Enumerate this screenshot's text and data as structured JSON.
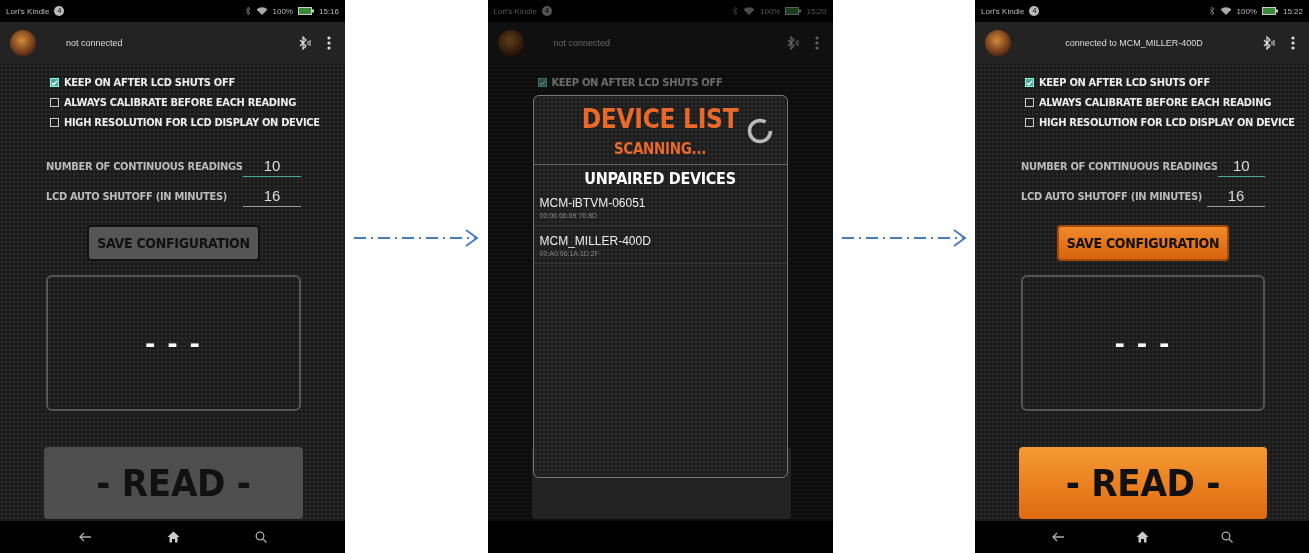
{
  "screens": [
    {
      "dimmed": false,
      "nav_buttons": true,
      "status_bar": {
        "device": "Lori's Kindle",
        "badge": "4",
        "battery": "100%",
        "time": "15:16"
      },
      "app_bar": {
        "status": "not connected"
      },
      "options": [
        {
          "label": "KEEP ON AFTER LCD SHUTS OFF",
          "checked": true
        },
        {
          "label": "ALWAYS CALIBRATE BEFORE EACH READING",
          "checked": false
        },
        {
          "label": "HIGH RESOLUTION FOR LCD DISPLAY ON DEVICE",
          "checked": false
        }
      ],
      "fields": [
        {
          "label": "NUMBER OF CONTINUOUS READINGS",
          "value": "10",
          "focused": true
        },
        {
          "label": "LCD AUTO SHUTOFF (IN MINUTES)",
          "value": "16",
          "focused": false
        }
      ],
      "save_button": {
        "label": "SAVE CONFIGURATION",
        "enabled": false
      },
      "display": {
        "value": "- - -"
      },
      "read_button": {
        "label": "- READ -",
        "enabled": false
      }
    },
    {
      "dimmed": true,
      "nav_buttons": false,
      "status_bar": {
        "device": "Lori's Kindle",
        "badge": "4",
        "battery": "100%",
        "time": "15:20"
      },
      "app_bar": {
        "status": "not connected"
      },
      "options": [
        {
          "label": "KEEP ON AFTER LCD SHUTS OFF",
          "checked": true
        }
      ],
      "read_button": {
        "enabled": false
      },
      "dialog": {
        "title": "DEVICE LIST",
        "subtitle": "SCANNING...",
        "section": "UNPAIRED DEVICES",
        "devices": [
          {
            "name": "MCM-iBTVM-06051",
            "address": "00:06:66:69:76:8D"
          },
          {
            "name": "MCM_MILLER-400D",
            "address": "00:A0:96:1A:1D:2F"
          }
        ]
      }
    },
    {
      "dimmed": false,
      "nav_buttons": true,
      "status_bar": {
        "device": "Lori's Kindle",
        "badge": "4",
        "battery": "100%",
        "time": "15:22"
      },
      "app_bar": {
        "status": "connected to MCM_MILLER-400D"
      },
      "options": [
        {
          "label": "KEEP ON AFTER LCD SHUTS OFF",
          "checked": true
        },
        {
          "label": "ALWAYS CALIBRATE BEFORE EACH READING",
          "checked": false
        },
        {
          "label": "HIGH RESOLUTION FOR LCD DISPLAY ON DEVICE",
          "checked": false
        }
      ],
      "fields": [
        {
          "label": "NUMBER OF CONTINUOUS READINGS",
          "value": "10",
          "focused": true
        },
        {
          "label": "LCD AUTO SHUTOFF (IN MINUTES)",
          "value": "16",
          "focused": false
        }
      ],
      "save_button": {
        "label": "SAVE CONFIGURATION",
        "enabled": true
      },
      "display": {
        "value": "- - -"
      },
      "read_button": {
        "label": "- READ -",
        "enabled": true
      }
    }
  ]
}
